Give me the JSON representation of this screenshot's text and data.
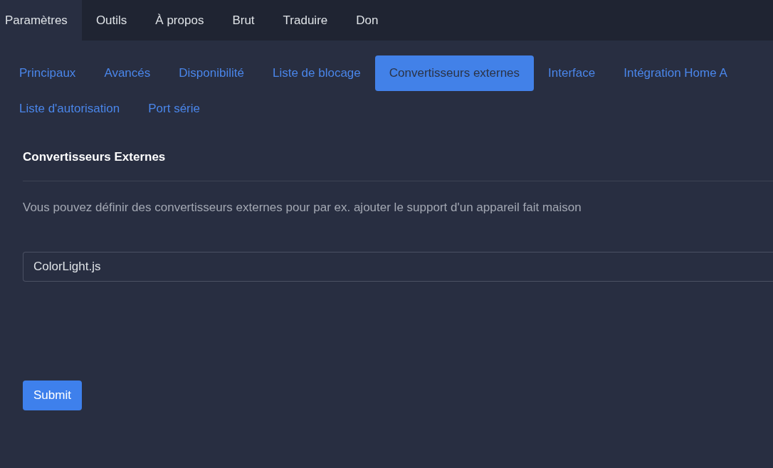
{
  "top_nav": [
    {
      "label": "Paramètres",
      "selected": true
    },
    {
      "label": "Outils",
      "selected": false
    },
    {
      "label": "À propos",
      "selected": false
    },
    {
      "label": "Brut",
      "selected": false
    },
    {
      "label": "Traduire",
      "selected": false
    },
    {
      "label": "Don",
      "selected": false
    }
  ],
  "settings_tabs": [
    {
      "label": "Principaux",
      "selected": false
    },
    {
      "label": "Avancés",
      "selected": false
    },
    {
      "label": "Disponibilité",
      "selected": false
    },
    {
      "label": "Liste de blocage",
      "selected": false
    },
    {
      "label": "Convertisseurs externes",
      "selected": true
    },
    {
      "label": "Interface",
      "selected": false
    },
    {
      "label": "Intégration Home A",
      "selected": false
    },
    {
      "label": "Liste d'autorisation",
      "selected": false
    },
    {
      "label": "Port série",
      "selected": false
    }
  ],
  "section": {
    "title": "Convertisseurs Externes",
    "description": "Vous pouvez définir des convertisseurs externes pour par ex. ajouter le support d'un appareil fait maison",
    "converters": [
      "ColorLight.js"
    ]
  },
  "submit_button": "Submit"
}
